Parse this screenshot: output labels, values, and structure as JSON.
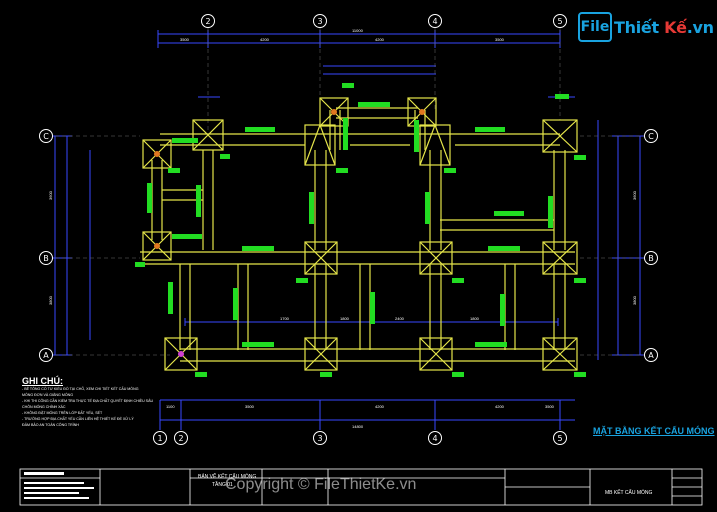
{
  "logo": {
    "icon": "file-icon",
    "brand_a": "File",
    "brand_b": "Thiết",
    "brand_c": "Kế",
    "brand_d": ".vn"
  },
  "grid": {
    "columns": [
      "2",
      "3",
      "4",
      "5"
    ],
    "columns_bottom": [
      "1",
      "2",
      "3",
      "4",
      "5"
    ],
    "rows": [
      "C",
      "B",
      "A"
    ]
  },
  "dimensions": {
    "overall_top": "11000",
    "overall_bottom": "14800",
    "top_segments": [
      "3500",
      "4200",
      "4200",
      "3500"
    ],
    "bottom_segments": [
      "1100",
      "3500",
      "4200",
      "4200",
      "3500"
    ],
    "left_side": [
      "3600",
      "3800"
    ],
    "right_side": [
      "3600",
      "3800"
    ],
    "inner": [
      "1700",
      "1800",
      "2400",
      "1800"
    ]
  },
  "notes": {
    "title": "GHI CHÚ:",
    "lines": [
      "- BÊ TÔNG CỐ TƯ KIỂU ĐỔ TẠI CHỖ, XEM CHI TIẾT KẾT CẤU MÓNG",
      "  MÓNG ĐƠN VÀ GIẰNG MÓNG",
      "- KHI THI CÔNG CẦN KIỂM TRA THỰC TẾ ĐỊA CHẤT QUYẾT ĐỊNH CHIỀU SÂU",
      "  CHÔN MÓNG CHÍNH XÁC",
      "- KHÔNG ĐẶT MÓNG TRÊN LỚP ĐẤT YẾU, SÉT",
      "- TRƯỜNG HỢP ĐỊA CHẤT YẾU CẦN LIÊN HỆ THIẾT KẾ ĐỂ XỬ LÝ",
      "  ĐẢM BẢO AN TOÀN CÔNG TRÌNH"
    ]
  },
  "plan_title": "MẶT BẰNG KẾT CẤU MÓNG",
  "watermark": "Copyright © FileThietKe.vn",
  "title_block": {
    "drawing_name": "BẢN VẼ KẾT CẤU MÓNG",
    "drawing_sub": "TẦNG 01",
    "right_name": "MB KẾT CẤU MÓNG"
  }
}
